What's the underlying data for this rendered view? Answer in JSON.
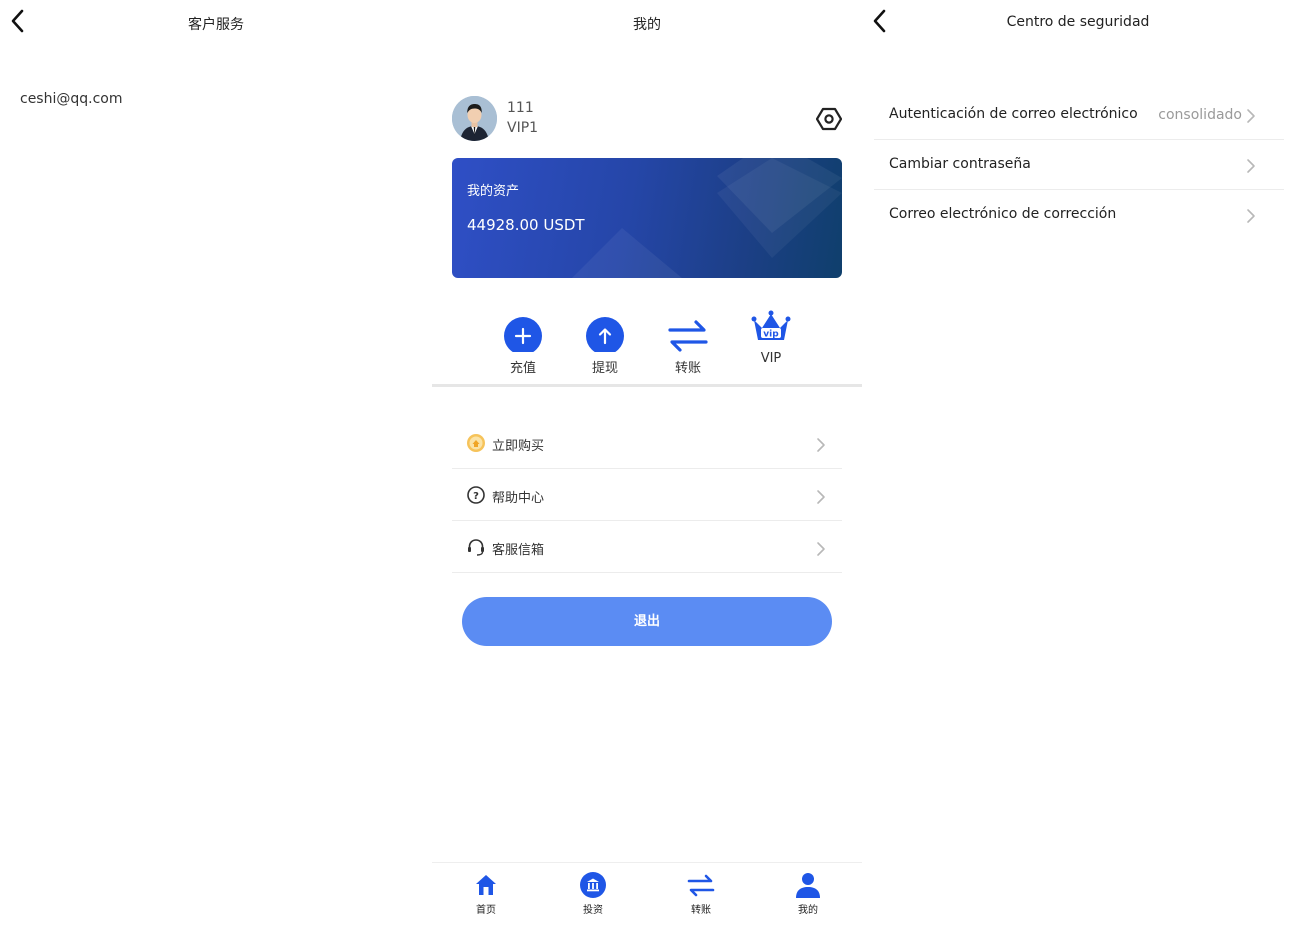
{
  "colors": {
    "accent": "#1f56e6",
    "logout_button": "#5b8cf3",
    "card_gradient_start": "#2f4fc6",
    "card_gradient_end": "#0f3f6c",
    "muted_text": "#9a9a9a",
    "gold_icon": "#f2b437"
  },
  "left_panel": {
    "title": "客户服务",
    "back_icon": "chevron-left-icon",
    "email": "ceshi@qq.com"
  },
  "mid_panel": {
    "title": "我的",
    "user": {
      "name": "111",
      "level": "VIP1",
      "avatar_icon": "user-avatar-icon",
      "settings_icon": "settings-hex-icon"
    },
    "assets": {
      "label": "我的资产",
      "amount": "44928.00 USDT"
    },
    "actions": [
      {
        "label": "充值",
        "icon": "plus-circle-icon"
      },
      {
        "label": "提现",
        "icon": "arrow-up-circle-icon"
      },
      {
        "label": "转账",
        "icon": "transfer-arrows-icon"
      },
      {
        "label": "VIP",
        "icon": "vip-crown-icon"
      }
    ],
    "menu": [
      {
        "label": "立即购买",
        "icon": "coin-icon"
      },
      {
        "label": "帮助中心",
        "icon": "question-circle-icon"
      },
      {
        "label": "客服信箱",
        "icon": "headset-icon"
      }
    ],
    "logout_label": "退出",
    "tabs": [
      {
        "label": "首页",
        "icon": "home-icon"
      },
      {
        "label": "投资",
        "icon": "bank-icon"
      },
      {
        "label": "转账",
        "icon": "transfer-arrows-icon"
      },
      {
        "label": "我的",
        "icon": "person-icon"
      }
    ]
  },
  "right_panel": {
    "title": "Centro de seguridad",
    "back_icon": "chevron-left-icon",
    "items": [
      {
        "label": "Autenticación de correo electrónico",
        "value": "consolidado"
      },
      {
        "label": "Cambiar contraseña",
        "value": ""
      },
      {
        "label": "Correo electrónico de corrección",
        "value": ""
      }
    ]
  }
}
